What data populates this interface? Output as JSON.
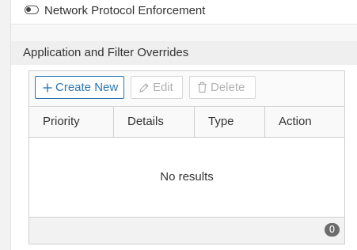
{
  "network_protocol": {
    "label": "Network Protocol Enforcement",
    "enabled": false
  },
  "overrides_section": {
    "title": "Application and Filter Overrides",
    "toolbar": {
      "create_new": "Create New",
      "edit": "Edit",
      "delete": "Delete"
    },
    "columns": [
      "Priority",
      "Details",
      "Type",
      "Action"
    ],
    "rows": [],
    "empty_message": "No results",
    "count": "0"
  },
  "colors": {
    "accent": "#2a76b5",
    "disabled": "#b1b1b1",
    "badge": "#6d6d6d"
  },
  "icons": {
    "toggle": "toggle-off-icon",
    "create": "plus-icon",
    "edit": "pencil-icon",
    "delete": "trash-icon"
  }
}
